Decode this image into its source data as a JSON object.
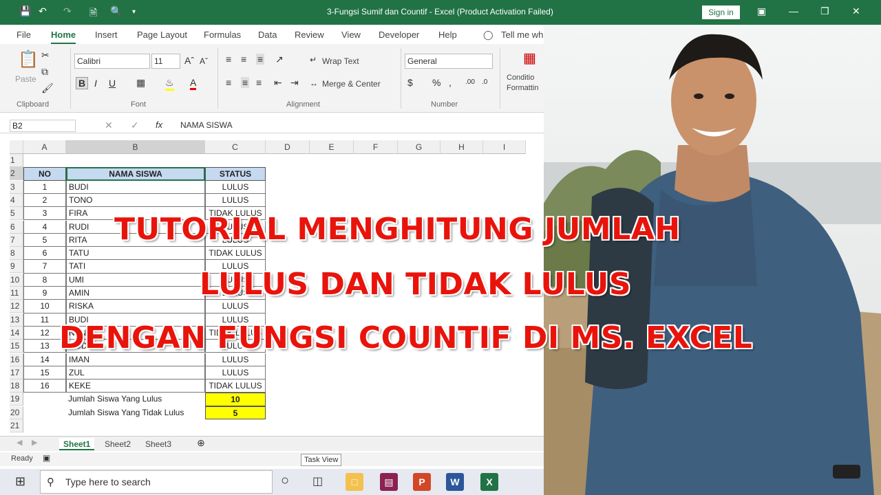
{
  "titlebar": {
    "title": "3-Fungsi Sumif dan Countif  -  Excel (Product Activation Failed)",
    "signin_label": "Sign in"
  },
  "menu": [
    "File",
    "Home",
    "Insert",
    "Page Layout",
    "Formulas",
    "Data",
    "Review",
    "View",
    "Developer",
    "Help",
    "Tell me wh"
  ],
  "ribbon": {
    "clipboard_label": "Clipboard",
    "paste_label": "Paste",
    "font_label": "Font",
    "font_name": "Calibri",
    "font_size": "11",
    "alignment_label": "Alignment",
    "wrap_text": "Wrap Text",
    "merge_center": "Merge & Center",
    "number_label": "Number",
    "number_format": "General",
    "conditional_formatting": "Conditio Formattin"
  },
  "formula_bar": {
    "name_box": "B2",
    "fx": "fx",
    "formula": "NAMA SISWA"
  },
  "columns": [
    "A",
    "B",
    "C",
    "D",
    "E",
    "F",
    "G",
    "H",
    "I"
  ],
  "rows": [
    "1",
    "2",
    "3",
    "4",
    "5",
    "6",
    "7",
    "8",
    "9",
    "10",
    "11",
    "12",
    "13",
    "14",
    "15",
    "16",
    "17",
    "18",
    "19",
    "20",
    "21"
  ],
  "table": {
    "headers": [
      "NO",
      "NAMA SISWA",
      "STATUS"
    ],
    "rows": [
      [
        "1",
        "BUDI",
        "LULUS"
      ],
      [
        "2",
        "TONO",
        "LULUS"
      ],
      [
        "3",
        "FIRA",
        "TIDAK LULUS"
      ],
      [
        "4",
        "RUDI",
        "LULUS"
      ],
      [
        "5",
        "RITA",
        "LULUS"
      ],
      [
        "6",
        "TATU",
        "TIDAK LULUS"
      ],
      [
        "7",
        "TATI",
        "LULUS"
      ],
      [
        "8",
        "UMI",
        "LULUS"
      ],
      [
        "9",
        "AMIN",
        "LULUS"
      ],
      [
        "10",
        "RISKA",
        "LULUS"
      ],
      [
        "11",
        "BUDI",
        "LULUS"
      ],
      [
        "12",
        "NANI",
        "TIDAK LULUS"
      ],
      [
        "13",
        "DODI",
        "LULUS"
      ],
      [
        "14",
        "IMAN",
        "LULUS"
      ],
      [
        "15",
        "ZUL",
        "LULUS"
      ],
      [
        "16",
        "KEKE",
        "TIDAK LULUS"
      ]
    ],
    "summary": [
      {
        "label": "Jumlah Siswa Yang Lulus",
        "value": "10"
      },
      {
        "label": "Jumlah Siswa Yang Tidak Lulus",
        "value": "5"
      }
    ]
  },
  "sheets": [
    "Sheet1",
    "Sheet2",
    "Sheet3"
  ],
  "status": {
    "ready": "Ready",
    "tooltip": "Task View"
  },
  "taskbar": {
    "search_placeholder": "Type here to search"
  },
  "headline": [
    "TUTORIAL MENGHITUNG JUMLAH",
    "LULUS DAN TIDAK LULUS",
    "DENGAN FUNGSI COUNTIF DI MS. EXCEL"
  ]
}
